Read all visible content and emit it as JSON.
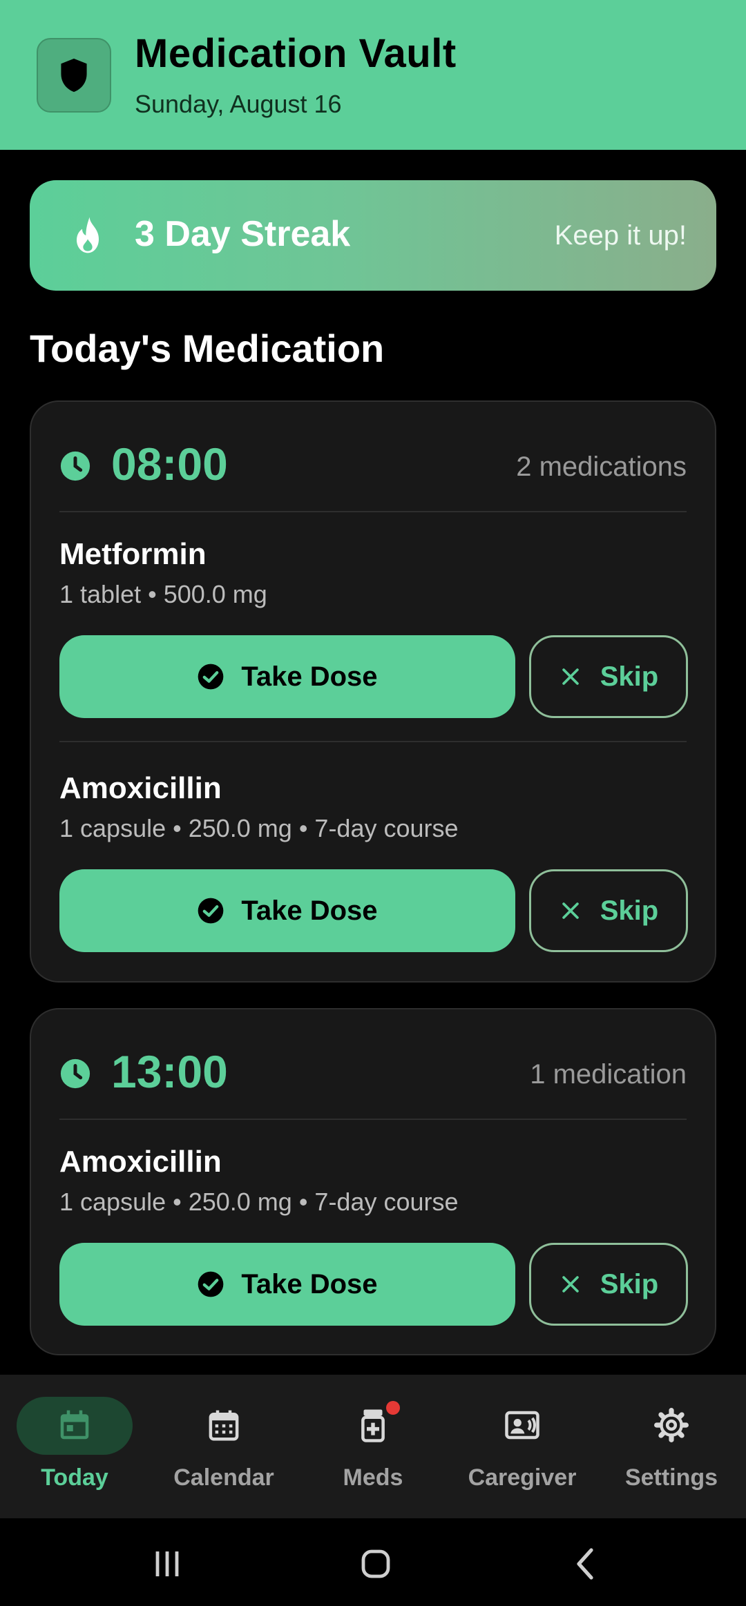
{
  "header": {
    "title": "Medication Vault",
    "date": "Sunday, August 16",
    "icon": "shield-icon"
  },
  "streak": {
    "title": "3 Day Streak",
    "subtitle": "Keep it up!",
    "icon": "flame-icon"
  },
  "section_title": "Today's Medication",
  "schedule": [
    {
      "time": "08:00",
      "count": "2 medications",
      "meds": [
        {
          "name": "Metformin",
          "detail": "1 tablet • 500.0 mg",
          "take_label": "Take Dose",
          "skip_label": "Skip"
        },
        {
          "name": "Amoxicillin",
          "detail": "1 capsule • 250.0 mg • 7-day course",
          "take_label": "Take Dose",
          "skip_label": "Skip"
        }
      ]
    },
    {
      "time": "13:00",
      "count": "1 medication",
      "meds": [
        {
          "name": "Amoxicillin",
          "detail": "1 capsule • 250.0 mg • 7-day course",
          "take_label": "Take Dose",
          "skip_label": "Skip"
        }
      ]
    }
  ],
  "nav": {
    "items": [
      {
        "label": "Today",
        "icon": "calendar-today-icon",
        "active": true
      },
      {
        "label": "Calendar",
        "icon": "calendar-icon",
        "active": false
      },
      {
        "label": "Meds",
        "icon": "medicine-bottle-icon",
        "active": false,
        "badge": true
      },
      {
        "label": "Caregiver",
        "icon": "contact-card-icon",
        "active": false
      },
      {
        "label": "Settings",
        "icon": "gear-icon",
        "active": false
      }
    ]
  },
  "colors": {
    "accent": "#5ccf99",
    "background": "#000000",
    "card": "#181818",
    "badge": "#e53935"
  }
}
